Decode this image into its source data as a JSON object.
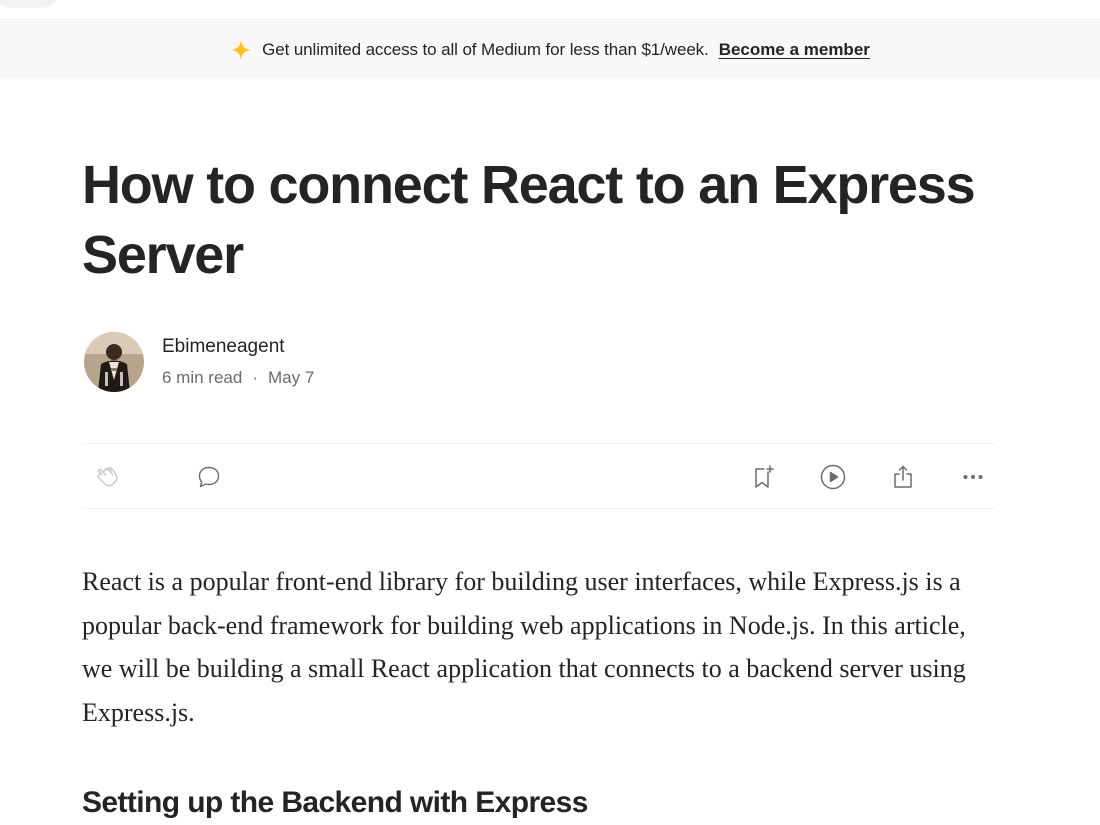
{
  "banner": {
    "message": "Get unlimited access to all of Medium for less than $1/week.",
    "cta_label": "Become a member",
    "icon": "sparkle-icon",
    "icon_color": "#ffc017"
  },
  "article": {
    "title": "How to connect React to an Express Server",
    "author": {
      "name": "Ebimeneagent",
      "read_time": "6 min read",
      "separator": "·",
      "date": "May 7"
    },
    "actions": {
      "left": [
        "clap-icon",
        "comment-icon"
      ],
      "right": [
        "bookmark-add-icon",
        "listen-play-icon",
        "share-icon",
        "more-icon"
      ]
    },
    "intro": "React is a popular front-end library for building user interfaces, while Express.js is a popular back-end framework for building web applications in Node.js. In this article, we will be building a small React application that connects to a backend server using Express.js.",
    "section_heading": "Setting up the Backend with Express"
  },
  "colors": {
    "text": "#242424",
    "muted": "#6b6b6b",
    "banner_bg": "#f9f8f9",
    "icon_gray": "#6b6b6b"
  }
}
